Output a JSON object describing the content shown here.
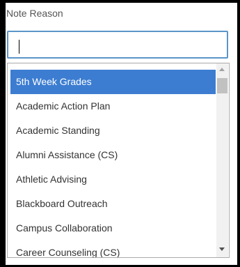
{
  "field": {
    "label": "Note Reason",
    "input_value": ""
  },
  "dropdown": {
    "selected_index": 0,
    "options": [
      {
        "label": "5th Week Grades"
      },
      {
        "label": "Academic Action Plan"
      },
      {
        "label": "Academic Standing"
      },
      {
        "label": "Alumni Assistance (CS)"
      },
      {
        "label": "Athletic Advising"
      },
      {
        "label": "Blackboard Outreach"
      },
      {
        "label": "Campus Collaboration"
      },
      {
        "label": "Career Counseling (CS)"
      }
    ]
  },
  "colors": {
    "selected_bg": "#3c7dd1",
    "input_border": "#5b95c9"
  }
}
